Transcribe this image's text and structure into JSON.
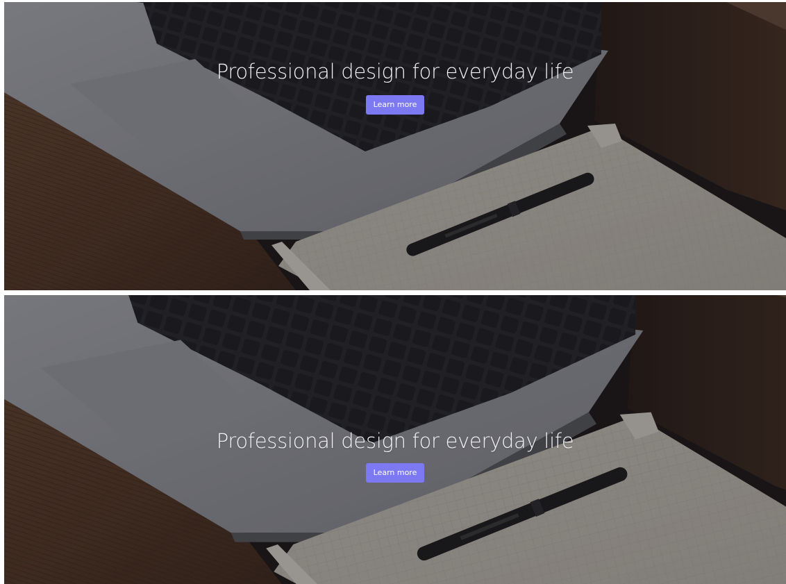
{
  "heroes": [
    {
      "title": "Professional design for everyday life",
      "button_label": "Learn more"
    },
    {
      "title": "Professional design for everyday life",
      "button_label": "Learn more"
    }
  ],
  "colors": {
    "button_bg": "#7d79f2",
    "title_text": "#f2f2f4",
    "divider": "#ffffff"
  },
  "icons": {
    "background": "laptop-notebook-pen-photo"
  }
}
